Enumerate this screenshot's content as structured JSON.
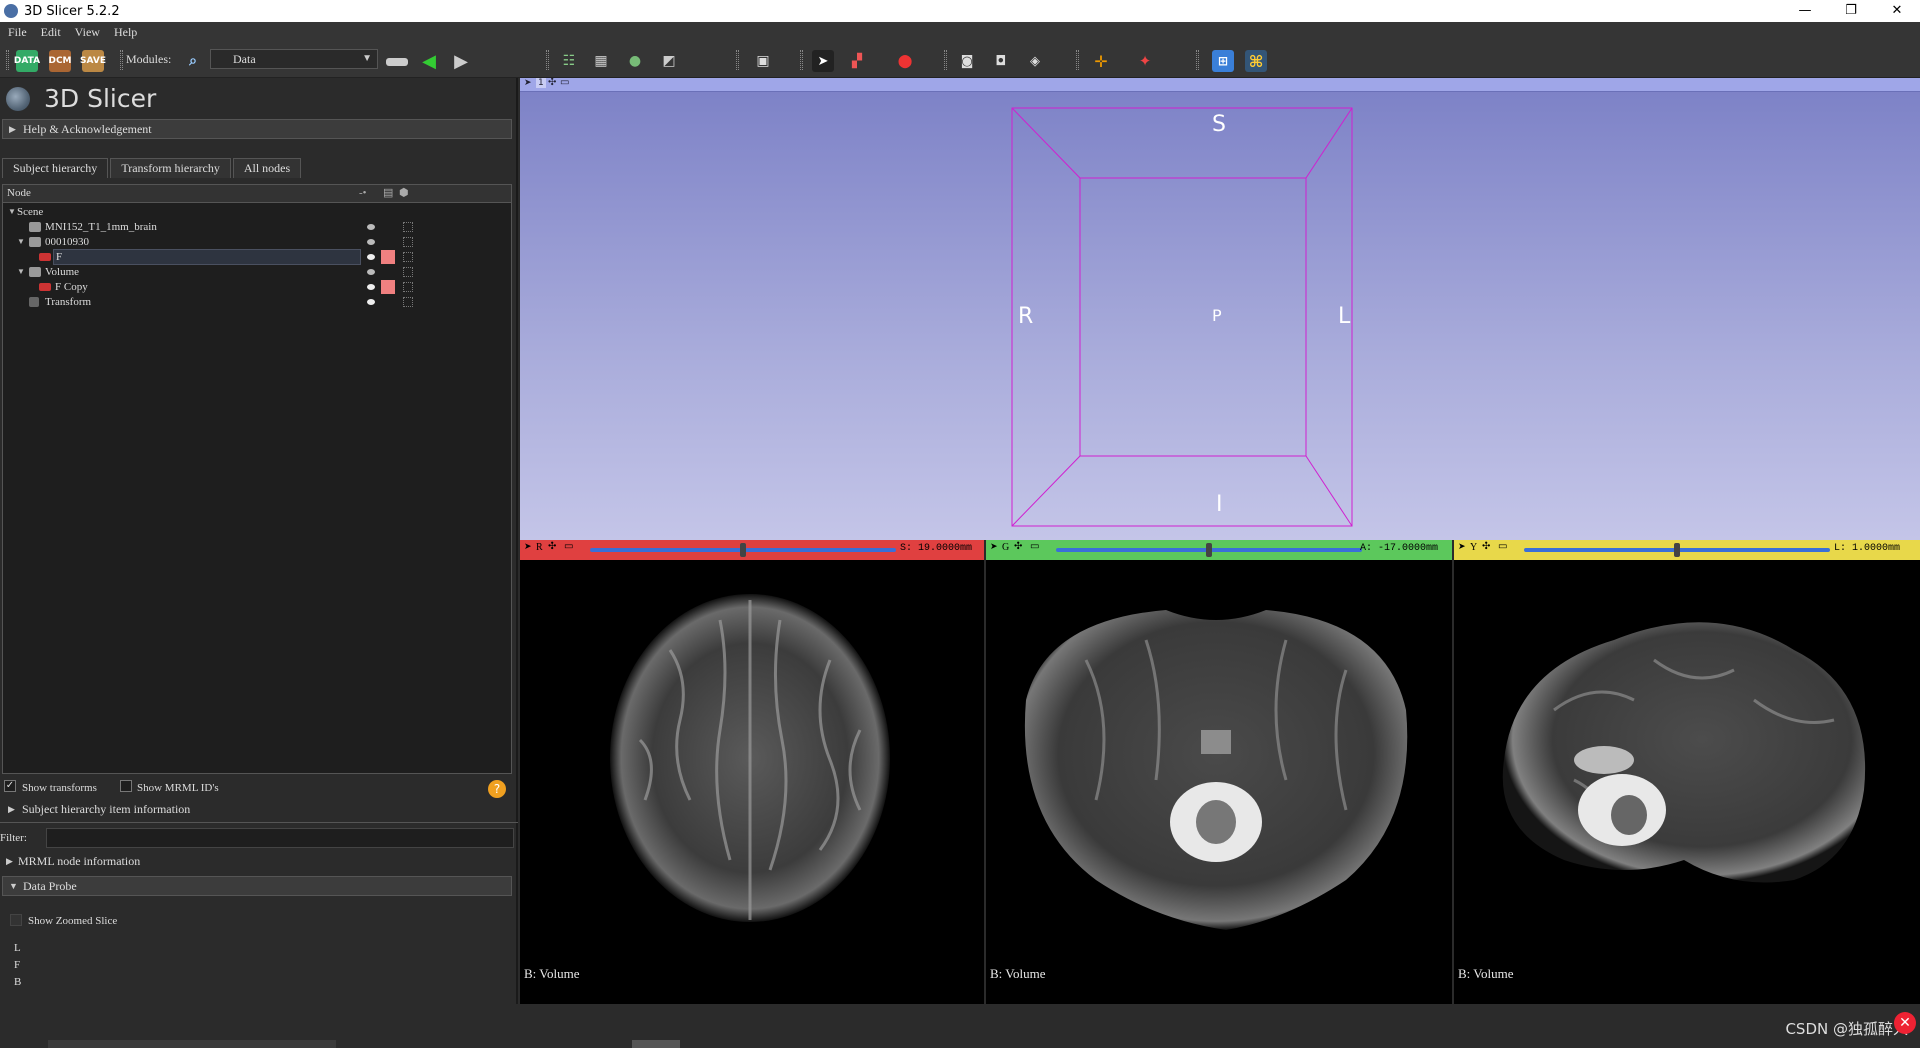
{
  "window": {
    "title": "3D Slicer 5.2.2",
    "minimize": "—",
    "restore": "❐",
    "close": "✕"
  },
  "menu": [
    "File",
    "Edit",
    "View",
    "Help"
  ],
  "toolbar": {
    "data_label": "DATA",
    "dcm_label": "DCM",
    "save_label": "SAVE",
    "modules_label": "Modules:",
    "module_selected": "Data"
  },
  "panel": {
    "app_name": "3D Slicer",
    "help_section": "Help & Acknowledgement",
    "tabs": [
      "Subject hierarchy",
      "Transform hierarchy",
      "All nodes"
    ],
    "tree_header": "Node",
    "tree": [
      {
        "label": "Scene"
      },
      {
        "label": "MNI152_T1_1mm_brain"
      },
      {
        "label": "00010930"
      },
      {
        "label": "F"
      },
      {
        "label": "Volume"
      },
      {
        "label": "F Copy"
      },
      {
        "label": "Transform"
      }
    ],
    "show_transforms": "Show transforms",
    "show_mrml_ids": "Show MRML ID's",
    "sh_item_info": "Subject hierarchy item information",
    "filter_label": "Filter:",
    "mrml_node_info": "MRML node information",
    "data_probe": "Data Probe",
    "show_zoomed_slice": "Show Zoomed Slice",
    "probe_layers": [
      "L",
      "F",
      "B"
    ]
  },
  "view3d": {
    "layout_num": "1",
    "orient": {
      "S": "S",
      "I": "I",
      "R": "R",
      "L": "L",
      "P": "P"
    },
    "box_color": "#d020d0"
  },
  "slices": [
    {
      "id": "R",
      "color": "#e04040",
      "offset": "S: 19.0000mm",
      "slider_pos": 0.5,
      "label": "B: Volume"
    },
    {
      "id": "G",
      "color": "#5cc85c",
      "offset": "A: -17.0000mm",
      "slider_pos": 0.5,
      "label": "B: Volume"
    },
    {
      "id": "Y",
      "color": "#e8d84a",
      "offset": "L: 1.0000mm",
      "slider_pos": 0.5,
      "label": "B: Volume"
    }
  ],
  "watermark": "CSDN @独孤醉人"
}
